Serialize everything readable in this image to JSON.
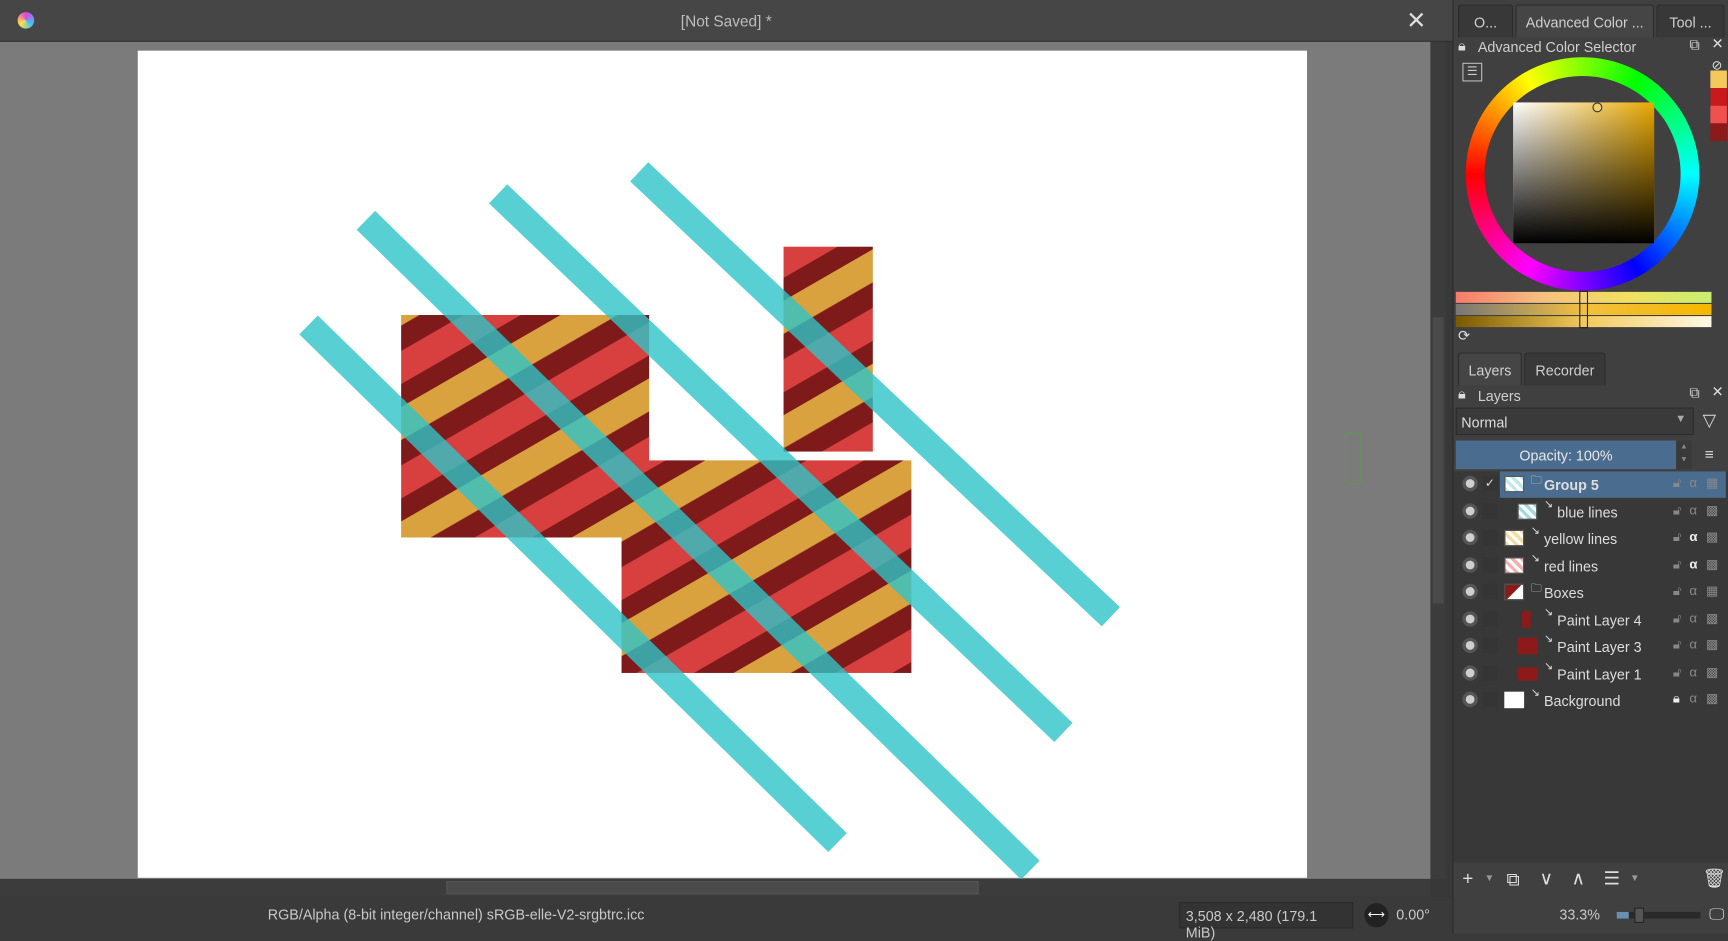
{
  "window": {
    "title": "[Not Saved]  *"
  },
  "status": {
    "color_model": "RGB/Alpha (8-bit integer/channel)  sRGB-elle-V2-srgbtrc.icc",
    "dimensions": "3,508 x 2,480 (179.1 MiB)",
    "rotation": "0.00°",
    "zoom": "33.3%",
    "zoom_slider_fraction": 0.15
  },
  "top_tabs": [
    "O...",
    "Advanced Color ...",
    "Tool ..."
  ],
  "color_selector": {
    "title": "Advanced Color Selector",
    "current_color": "#f2c95a",
    "history_colors": [
      "#f2c95a",
      "#c8191e",
      "#f05050",
      "#8c1a1a"
    ]
  },
  "bottom_tabs": [
    "Layers",
    "Recorder"
  ],
  "layers_panel": {
    "title": "Layers",
    "blend_mode": "Normal",
    "opacity": "Opacity:  100%",
    "layers": [
      {
        "name": "Group 5",
        "selected": true,
        "indent": 0,
        "type": "group"
      },
      {
        "name": "blue lines",
        "indent": 1,
        "type": "paint"
      },
      {
        "name": "yellow lines",
        "indent": 0,
        "type": "paint"
      },
      {
        "name": "red lines",
        "indent": 0,
        "type": "paint"
      },
      {
        "name": "Boxes",
        "indent": 0,
        "type": "group"
      },
      {
        "name": "Paint Layer 4",
        "indent": 1,
        "type": "paint"
      },
      {
        "name": "Paint Layer 3",
        "indent": 1,
        "type": "paint"
      },
      {
        "name": "Paint Layer 1",
        "indent": 1,
        "type": "paint"
      },
      {
        "name": "Background",
        "indent": 0,
        "type": "paint",
        "locked": true
      }
    ]
  }
}
